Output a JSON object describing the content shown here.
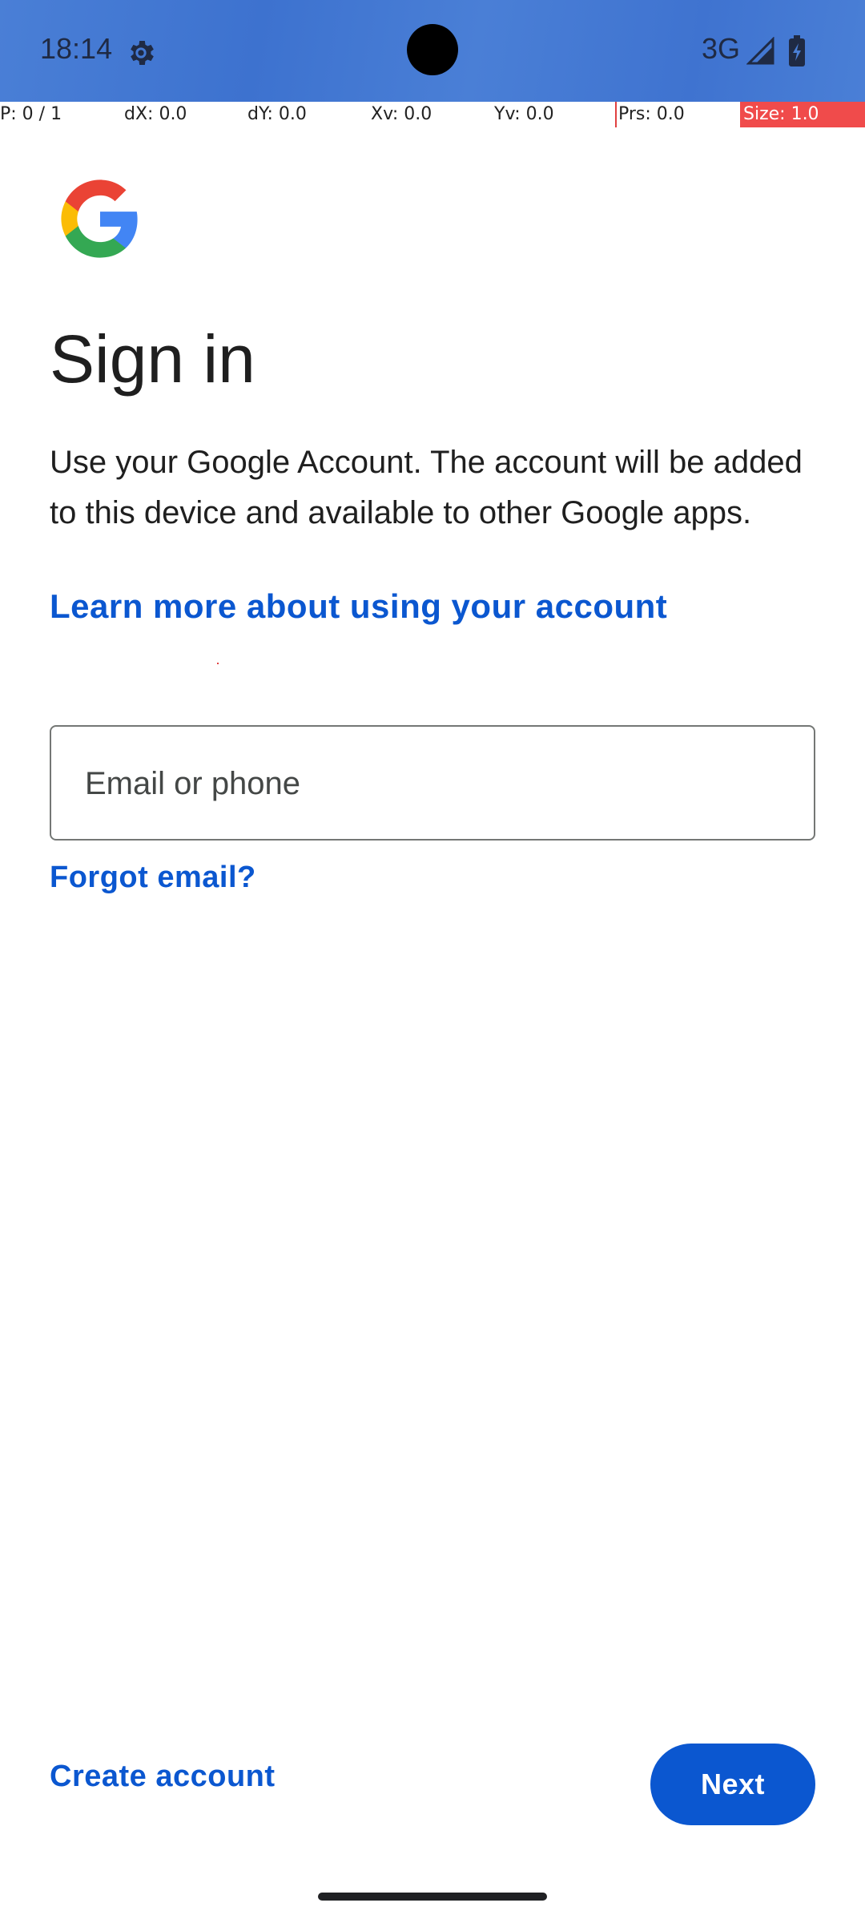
{
  "status_bar": {
    "time": "18:14",
    "network": "3G",
    "icons": [
      "settings-gear-icon",
      "signal-icon",
      "battery-icon"
    ]
  },
  "debug_overlay": {
    "pointer": "P: 0 / 1",
    "dx": "dX: 0.0",
    "dy": "dY: 0.0",
    "xv": "Xv: 0.0",
    "yv": "Yv: 0.0",
    "prs": "Prs: 0.0",
    "size": "Size: 1.0"
  },
  "signin": {
    "logo": "google-g-logo",
    "title": "Sign in",
    "description": "Use your Google Account. The account will be added to this device and available to other Google apps.",
    "learn_more": "Learn more about using your account",
    "email_placeholder": "Email or phone",
    "email_value": "",
    "forgot_email": "Forgot email?",
    "create_account": "Create account",
    "next": "Next"
  },
  "colors": {
    "status_bar": "#4a7fd6",
    "link": "#0b57d0",
    "primary_button": "#0b57d0",
    "text": "#1f1f1f"
  }
}
